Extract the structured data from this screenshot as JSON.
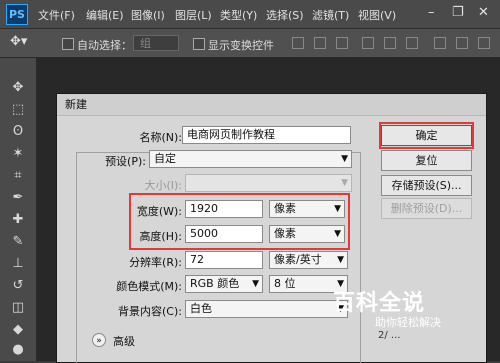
{
  "app": {
    "logo": "PS"
  },
  "menu": [
    "文件(F)",
    "编辑(E)",
    "图像(I)",
    "图层(L)",
    "类型(Y)",
    "选择(S)",
    "滤镜(T)",
    "视图(V)"
  ],
  "window_controls": {
    "minimize": "–",
    "restore": "❐",
    "close": "✕"
  },
  "options_bar": {
    "auto_select_label": "自动选择：",
    "group_value": "组",
    "show_transform_label": "显示变换控件"
  },
  "tools": [
    "move-tool-icon",
    "marquee-tool-icon",
    "lasso-tool-icon",
    "magic-wand-icon",
    "crop-tool-icon",
    "eyedropper-icon",
    "healing-brush-icon",
    "brush-icon",
    "clone-stamp-icon",
    "history-brush-icon",
    "eraser-icon",
    "paint-bucket-icon",
    "blur-tool-icon"
  ],
  "dialog": {
    "title": "新建",
    "name_label": "名称(N):",
    "name_value": "电商网页制作教程",
    "preset_label": "预设(P):",
    "preset_value": "自定",
    "size_label": "大小(I):",
    "size_value": "",
    "width_label": "宽度(W):",
    "width_value": "1920",
    "width_unit": "像素",
    "height_label": "高度(H):",
    "height_value": "5000",
    "height_unit": "像素",
    "resolution_label": "分辨率(R):",
    "resolution_value": "72",
    "resolution_unit": "像素/英寸",
    "color_mode_label": "颜色模式(M):",
    "color_mode_value": "RGB 颜色",
    "bit_depth_value": "8 位",
    "background_label": "背景内容(C):",
    "background_value": "白色",
    "advanced_label": "高级",
    "image_size_label": "2/ ...",
    "buttons": {
      "ok": "确定",
      "reset": "复位",
      "save_preset": "存储预设(S)...",
      "delete_preset": "删除预设(D)..."
    }
  },
  "watermark": {
    "title": "百科全说",
    "subtitle": "助你轻松解决"
  },
  "colors": {
    "highlight_box": "#e03a3a",
    "ps_blue": "#30a6ff"
  }
}
